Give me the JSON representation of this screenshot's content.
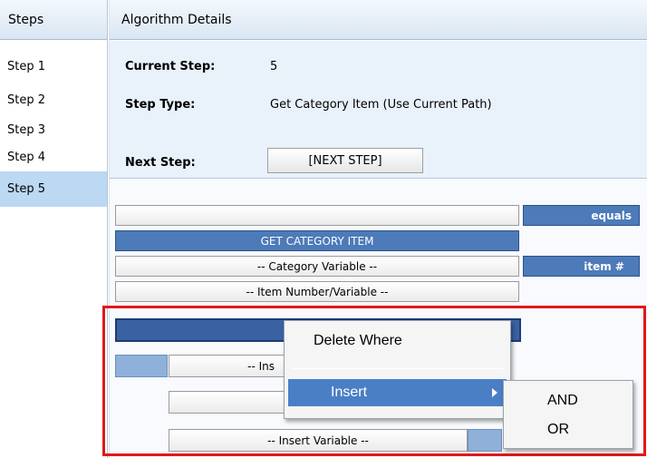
{
  "steps_panel": {
    "title": "Steps",
    "items": [
      {
        "label": "Step 1"
      },
      {
        "label": "Step 2"
      },
      {
        "label": "Step 3"
      },
      {
        "label": "Step 4"
      },
      {
        "label": "Step 5",
        "active": true
      }
    ]
  },
  "details_panel": {
    "title": "Algorithm Details",
    "current_step_label": "Current Step:",
    "current_step_value": "5",
    "step_type_label": "Step Type:",
    "step_type_value": "Get Category Item (Use Current Path)",
    "next_step_label": "Next Step:",
    "next_step_button": "[NEXT STEP]"
  },
  "algorithm": {
    "equals_label": "equals",
    "get_category_item": "GET CATEGORY ITEM",
    "category_variable": "-- Category Variable --",
    "item_number_label": "item #",
    "item_number_variable": "-- Item Number/Variable --",
    "insert_partial": "-- Ins",
    "insert_variable": "-- Insert Variable --"
  },
  "context_menu": {
    "delete_where": "Delete Where",
    "insert": "Insert",
    "submenu": [
      "AND",
      "OR"
    ]
  },
  "colors": {
    "header_gradient_top": "#f3f8fd",
    "active_step_bg": "#bcd8f2",
    "bar_blue": "#4d7ab8",
    "menu_highlight": "#4a7fc6",
    "highlight_border": "#e01818"
  }
}
